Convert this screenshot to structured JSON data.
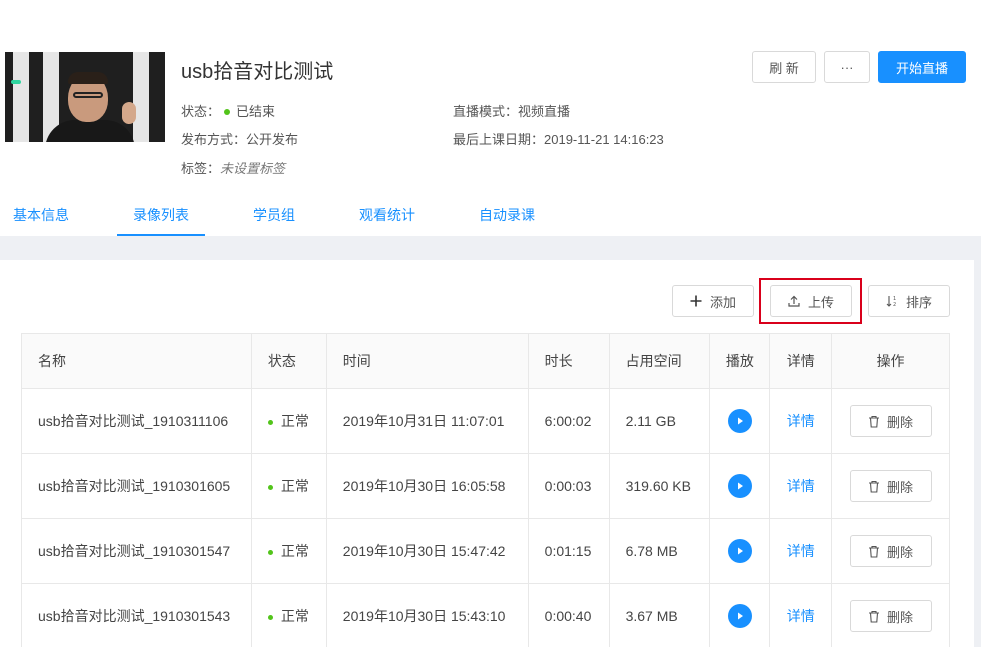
{
  "header": {
    "title": "usb拾音对比测试",
    "status_label": "状态：",
    "status_value": "已结束",
    "publish_label": "发布方式：",
    "publish_value": "公开发布",
    "tags_label": "标签：",
    "tags_value": "未设置标签",
    "mode_label": "直播模式：",
    "mode_value": "视频直播",
    "last_class_label": "最后上课日期：",
    "last_class_value": "2019-11-21 14:16:23",
    "refresh_label": "刷 新",
    "more_label": "···",
    "start_live_label": "开始直播"
  },
  "tabs": [
    "基本信息",
    "录像列表",
    "学员组",
    "观看统计",
    "自动录课"
  ],
  "toolbar": {
    "add_label": "添加",
    "upload_label": "上传",
    "sort_label": "排序"
  },
  "table": {
    "headers": [
      "名称",
      "状态",
      "时间",
      "时长",
      "占用空间",
      "播放",
      "详情",
      "操作"
    ],
    "rows": [
      {
        "name": "usb拾音对比测试_1910311106",
        "status": "正常",
        "time": "2019年10月31日 11:07:01",
        "duration": "6:00:02",
        "size": "2.11 GB",
        "detail": "详情",
        "action": "删除"
      },
      {
        "name": "usb拾音对比测试_1910301605",
        "status": "正常",
        "time": "2019年10月30日 16:05:58",
        "duration": "0:00:03",
        "size": "319.60 KB",
        "detail": "详情",
        "action": "删除"
      },
      {
        "name": "usb拾音对比测试_1910301547",
        "status": "正常",
        "time": "2019年10月30日 15:47:42",
        "duration": "0:01:15",
        "size": "6.78 MB",
        "detail": "详情",
        "action": "删除"
      },
      {
        "name": "usb拾音对比测试_1910301543",
        "status": "正常",
        "time": "2019年10月30日 15:43:10",
        "duration": "0:00:40",
        "size": "3.67 MB",
        "detail": "详情",
        "action": "删除"
      }
    ]
  },
  "colors": {
    "primary": "#1890ff",
    "success": "#52c41a",
    "highlight": "#d9001b"
  }
}
